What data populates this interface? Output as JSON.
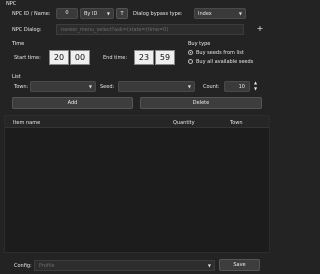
{
  "npc": {
    "section": "NPC",
    "id_name_label": "NPC ID / Name:",
    "id_value": "0",
    "search_by": "By ID",
    "search_btn": "T",
    "bypass_label": "Dialog bypass type:",
    "bypass_value": "Index",
    "dialog_label": "NPC Dialog:",
    "dialog_placeholder": "nareer_menu_select?ask=(state=(time=0)",
    "dialog_add": "+"
  },
  "time": {
    "section": "Time",
    "start_label": "Start time:",
    "start_h": "20",
    "start_m": "00",
    "end_label": "End time:",
    "end_h": "23",
    "end_m": "59"
  },
  "buy_type": {
    "section": "Buy type",
    "options": [
      "Buy seeds from list",
      "Buy all available seeds"
    ],
    "selected": 0
  },
  "list": {
    "section": "List",
    "town_label": "Town:",
    "seed_label": "Seed:",
    "count_label": "Count:",
    "count_value": "10",
    "add_label": "Add",
    "delete_label": "Delete",
    "columns": [
      "Item name",
      "Quantity",
      "Town"
    ],
    "rows": []
  },
  "footer": {
    "config_label": "Config:",
    "config_placeholder": "Profile",
    "save_label": "Save"
  }
}
